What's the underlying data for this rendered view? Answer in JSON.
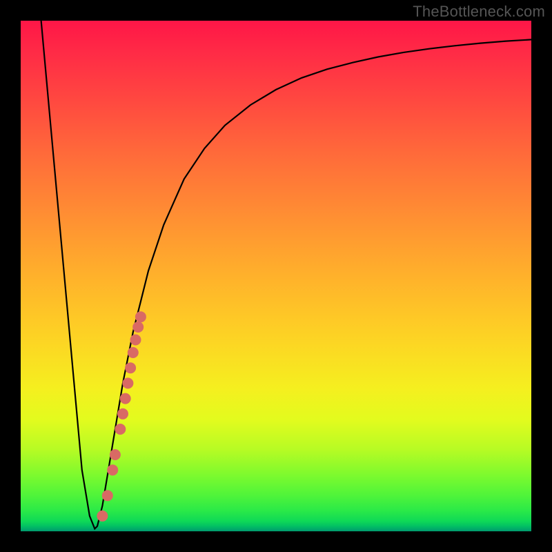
{
  "watermark": "TheBottleneck.com",
  "colors": {
    "frame": "#000000",
    "curve": "#000000",
    "scatter": "#d96a64",
    "gradient_top": "#ff1647",
    "gradient_bottom": "#009a6e"
  },
  "chart_data": {
    "type": "line",
    "title": "",
    "xlabel": "",
    "ylabel": "",
    "xlim": [
      0,
      100
    ],
    "ylim": [
      0,
      100
    ],
    "annotations": [],
    "series": [
      {
        "name": "bottleneck-curve",
        "x": [
          4,
          6,
          8,
          10,
          12,
          13.5,
          14.5,
          15,
          16,
          18,
          20,
          22,
          25,
          28,
          32,
          36,
          40,
          45,
          50,
          55,
          60,
          65,
          70,
          75,
          80,
          85,
          90,
          95,
          100
        ],
        "y": [
          100,
          78,
          56,
          34,
          12,
          3,
          0.5,
          1,
          5,
          17,
          29,
          39,
          51,
          60,
          69,
          75,
          79.5,
          83.5,
          86.5,
          88.8,
          90.5,
          91.8,
          92.9,
          93.8,
          94.5,
          95.1,
          95.6,
          96,
          96.3
        ]
      }
    ],
    "scatter": [
      {
        "name": "highlight-points",
        "points": [
          {
            "x": 16.0,
            "y": 3.0
          },
          {
            "x": 17.0,
            "y": 7.0
          },
          {
            "x": 18.0,
            "y": 12.0
          },
          {
            "x": 18.5,
            "y": 15.0
          },
          {
            "x": 19.5,
            "y": 20.0
          },
          {
            "x": 20.0,
            "y": 23.0
          },
          {
            "x": 20.5,
            "y": 26.0
          },
          {
            "x": 21.0,
            "y": 29.0
          },
          {
            "x": 21.5,
            "y": 32.0
          },
          {
            "x": 22.0,
            "y": 35.0
          },
          {
            "x": 22.5,
            "y": 37.5
          },
          {
            "x": 23.0,
            "y": 40.0
          },
          {
            "x": 23.5,
            "y": 42.0
          }
        ]
      }
    ]
  }
}
